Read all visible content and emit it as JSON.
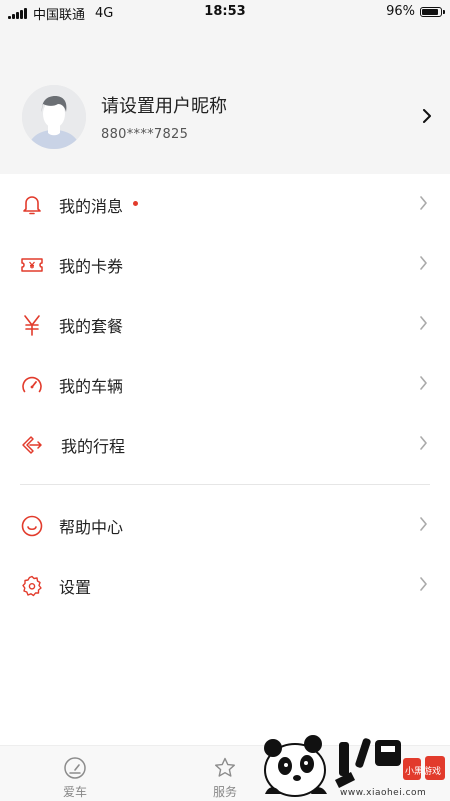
{
  "status_bar": {
    "carrier": "中国联通",
    "network": "4G",
    "time": "18:53",
    "battery": "96%",
    "battery_level": 0.96
  },
  "profile": {
    "nickname": "请设置用户昵称",
    "phone": "880****7825"
  },
  "menu": {
    "items": [
      {
        "label": "我的消息",
        "icon": "bell-icon",
        "has_badge": true
      },
      {
        "label": "我的卡券",
        "icon": "ticket-icon"
      },
      {
        "label": "我的套餐",
        "icon": "yen-icon"
      },
      {
        "label": "我的车辆",
        "icon": "speedometer-icon"
      },
      {
        "label": "我的行程",
        "icon": "route-icon"
      },
      {
        "label": "帮助中心",
        "icon": "smile-icon"
      },
      {
        "label": "设置",
        "icon": "gear-icon"
      }
    ]
  },
  "tab_bar": {
    "tabs": [
      {
        "label": "爱车",
        "icon": "gauge-icon"
      },
      {
        "label": "服务",
        "icon": "star-icon"
      }
    ]
  },
  "watermark": {
    "brand": "小黑游戏",
    "url": "www.xiaohei.com"
  },
  "colors": {
    "accent": "#e23b2c",
    "background": "#f5f5f5",
    "text": "#222222",
    "secondary_text": "#888888"
  }
}
